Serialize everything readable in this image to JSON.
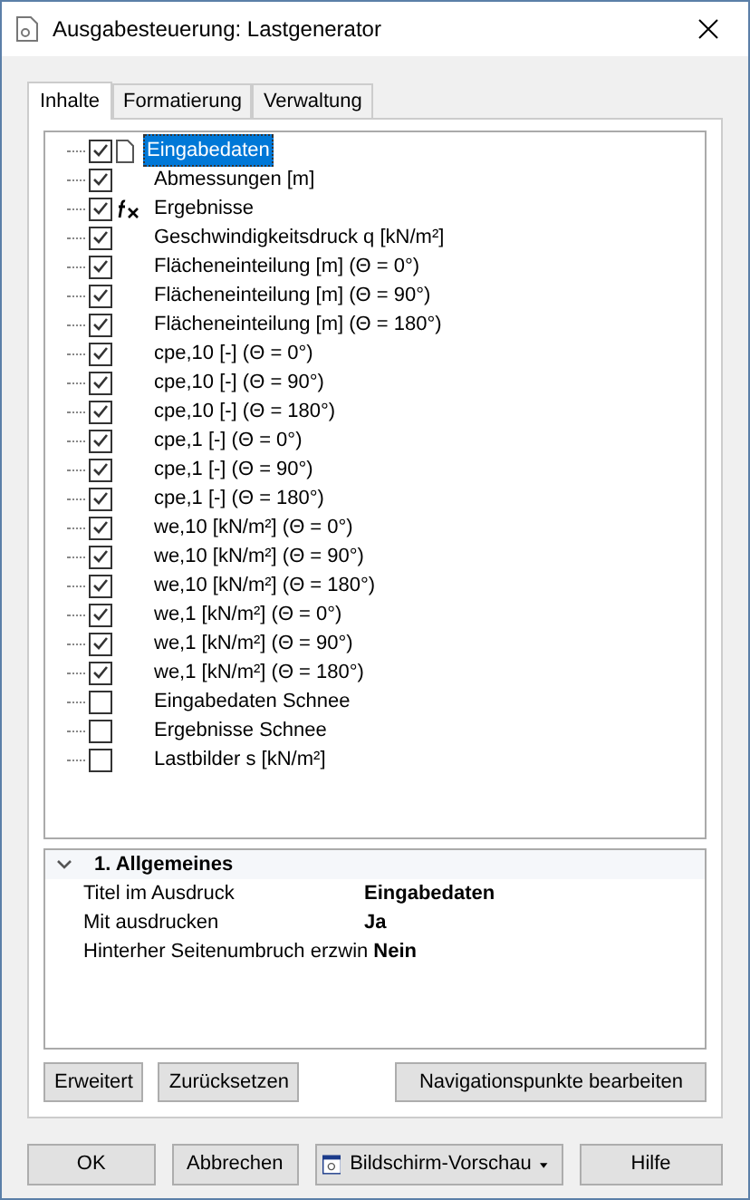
{
  "window": {
    "title": "Ausgabesteuerung: Lastgenerator"
  },
  "tabs": [
    {
      "label": "Inhalte",
      "selected": true
    },
    {
      "label": "Formatierung",
      "selected": false
    },
    {
      "label": "Verwaltung",
      "selected": false
    }
  ],
  "tree": [
    {
      "label": "Eingabedaten",
      "checked": true,
      "selected": true,
      "kind": "page"
    },
    {
      "label": "Abmessungen [m]",
      "checked": true,
      "selected": false,
      "kind": "none"
    },
    {
      "label": "Ergebnisse",
      "checked": true,
      "selected": false,
      "kind": "formula"
    },
    {
      "label": "Geschwindigkeitsdruck q [kN/m²]",
      "checked": true,
      "selected": false,
      "kind": "none"
    },
    {
      "label": "Flächeneinteilung [m] (Θ = 0°)",
      "checked": true,
      "selected": false,
      "kind": "none"
    },
    {
      "label": "Flächeneinteilung [m] (Θ = 90°)",
      "checked": true,
      "selected": false,
      "kind": "none"
    },
    {
      "label": "Flächeneinteilung [m] (Θ = 180°)",
      "checked": true,
      "selected": false,
      "kind": "none"
    },
    {
      "label": "cpe,10 [-] (Θ = 0°)",
      "checked": true,
      "selected": false,
      "kind": "none"
    },
    {
      "label": "cpe,10 [-] (Θ = 90°)",
      "checked": true,
      "selected": false,
      "kind": "none"
    },
    {
      "label": "cpe,10 [-] (Θ = 180°)",
      "checked": true,
      "selected": false,
      "kind": "none"
    },
    {
      "label": "cpe,1 [-] (Θ = 0°)",
      "checked": true,
      "selected": false,
      "kind": "none"
    },
    {
      "label": "cpe,1 [-] (Θ = 90°)",
      "checked": true,
      "selected": false,
      "kind": "none"
    },
    {
      "label": "cpe,1 [-] (Θ = 180°)",
      "checked": true,
      "selected": false,
      "kind": "none"
    },
    {
      "label": "we,10 [kN/m²] (Θ = 0°)",
      "checked": true,
      "selected": false,
      "kind": "none"
    },
    {
      "label": "we,10 [kN/m²] (Θ = 90°)",
      "checked": true,
      "selected": false,
      "kind": "none"
    },
    {
      "label": "we,10 [kN/m²] (Θ = 180°)",
      "checked": true,
      "selected": false,
      "kind": "none"
    },
    {
      "label": "we,1 [kN/m²] (Θ = 0°)",
      "checked": true,
      "selected": false,
      "kind": "none"
    },
    {
      "label": "we,1 [kN/m²] (Θ = 90°)",
      "checked": true,
      "selected": false,
      "kind": "none"
    },
    {
      "label": "we,1 [kN/m²] (Θ = 180°)",
      "checked": true,
      "selected": false,
      "kind": "none"
    },
    {
      "label": "Eingabedaten Schnee",
      "checked": false,
      "selected": false,
      "kind": "none"
    },
    {
      "label": "Ergebnisse Schnee",
      "checked": false,
      "selected": false,
      "kind": "none"
    },
    {
      "label": "Lastbilder s [kN/m²]",
      "checked": false,
      "selected": false,
      "kind": "none"
    }
  ],
  "properties": {
    "section": "1. Allgemeines",
    "expanded": true,
    "rows": [
      {
        "name": "Titel im Ausdruck",
        "value": "Eingabedaten"
      },
      {
        "name": "Mit ausdrucken",
        "value": "Ja"
      },
      {
        "name": "Hinterher Seitenumbruch erzwin",
        "value": "Nein"
      }
    ]
  },
  "panel_buttons": [
    "Erweitert",
    "Zurücksetzen",
    "Navigationspunkte bearbeiten"
  ],
  "dialog_buttons": [
    {
      "label": "OK",
      "kind": "plain"
    },
    {
      "label": "Abbrechen",
      "kind": "plain"
    },
    {
      "label": "Bildschirm-Vorschau",
      "kind": "dropdown"
    },
    {
      "label": "Hilfe",
      "kind": "plain"
    }
  ]
}
